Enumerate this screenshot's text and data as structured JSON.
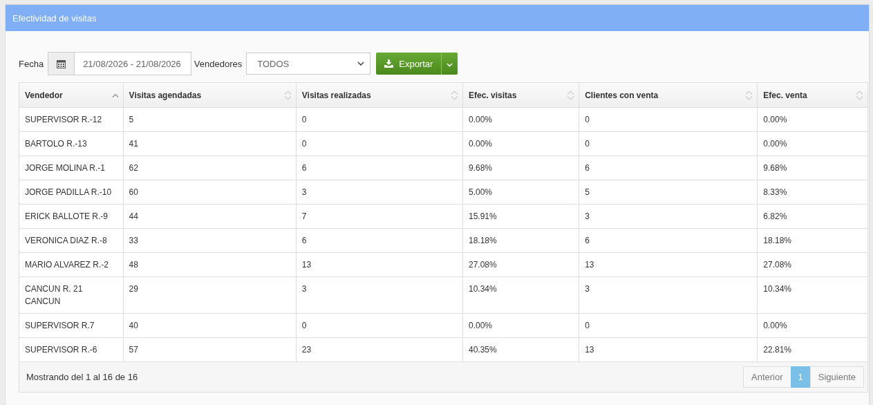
{
  "panel": {
    "title": "Efectividad de visitas"
  },
  "filters": {
    "date_label": "Fecha",
    "date_value": "21/08/2026 - 21/08/2026",
    "sellers_label": "Vendedores",
    "sellers_value": "TODOS",
    "export_button": "Exportar"
  },
  "table": {
    "columns": [
      {
        "label": "Vendedor",
        "sorted": true
      },
      {
        "label": "Visitas agendadas",
        "sorted": false
      },
      {
        "label": "Visitas realizadas",
        "sorted": false
      },
      {
        "label": "Efec. visitas",
        "sorted": false
      },
      {
        "label": "Clientes con venta",
        "sorted": false
      },
      {
        "label": "Efec. venta",
        "sorted": false
      }
    ],
    "rows": [
      [
        "SUPERVISOR R.-12",
        "5",
        "0",
        "0.00%",
        "0",
        "0.00%"
      ],
      [
        "BARTOLO R.-13",
        "41",
        "0",
        "0.00%",
        "0",
        "0.00%"
      ],
      [
        "JORGE MOLINA R.-1",
        "62",
        "6",
        "9.68%",
        "6",
        "9.68%"
      ],
      [
        "JORGE PADILLA R.-10",
        "60",
        "3",
        "5.00%",
        "5",
        "8.33%"
      ],
      [
        "ERICK BALLOTE R.-9",
        "44",
        "7",
        "15.91%",
        "3",
        "6.82%"
      ],
      [
        "VERONICA DIAZ R.-8",
        "33",
        "6",
        "18.18%",
        "6",
        "18.18%"
      ],
      [
        "MARIO ALVAREZ R.-2",
        "48",
        "13",
        "27.08%",
        "13",
        "27.08%"
      ],
      [
        "CANCUN R. 21 CANCUN",
        "29",
        "3",
        "10.34%",
        "3",
        "10.34%"
      ],
      [
        "SUPERVISOR R.7",
        "40",
        "0",
        "0.00%",
        "0",
        "0.00%"
      ],
      [
        "SUPERVISOR R.-6",
        "57",
        "23",
        "40.35%",
        "13",
        "22.81%"
      ]
    ]
  },
  "footer": {
    "info": "Mostrando del 1 al 16 de 16",
    "pagination": [
      {
        "label": "Anterior",
        "selected": false
      },
      {
        "label": "1",
        "selected": true
      },
      {
        "label": "Siguiente",
        "selected": false
      }
    ]
  }
}
